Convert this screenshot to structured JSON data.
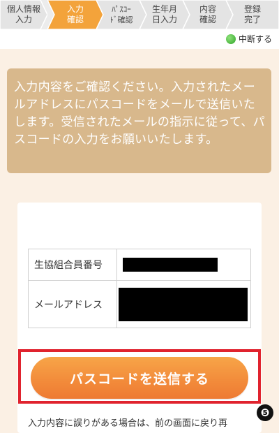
{
  "steps": [
    {
      "line1": "個人情報",
      "line2": "入力",
      "active": false
    },
    {
      "line1": "入力",
      "line2": "確認",
      "active": true
    },
    {
      "line1": "ﾊﾟｽｺｰ",
      "line2": "ﾄﾞ確認",
      "active": false
    },
    {
      "line1": "生年月",
      "line2": "日入力",
      "active": false
    },
    {
      "line1": "内容",
      "line2": "確認",
      "active": false
    },
    {
      "line1": "登録",
      "line2": "完了",
      "active": false
    }
  ],
  "pause_label": "中断する",
  "notice_text": "入力内容をご確認ください。入力されたメールアドレスにパスコードをメールで送信いたします。受信されたメールの指示に従って、パスコードの入力をお願いいたします。",
  "table": {
    "rows": [
      {
        "key": "生協組合員番号"
      },
      {
        "key": "メールアドレス"
      }
    ]
  },
  "send_button_label": "パスコードを送信する",
  "badge_number": "❺",
  "footnote": "入力内容に誤りがある場合は、前の画面に戻り再",
  "colors": {
    "accent": "#f3a33b",
    "notice_bg": "#d8b88c",
    "button_orange": "#f28a3a",
    "highlight_red": "#e0232e",
    "page_bg": "#fbf0e4"
  }
}
